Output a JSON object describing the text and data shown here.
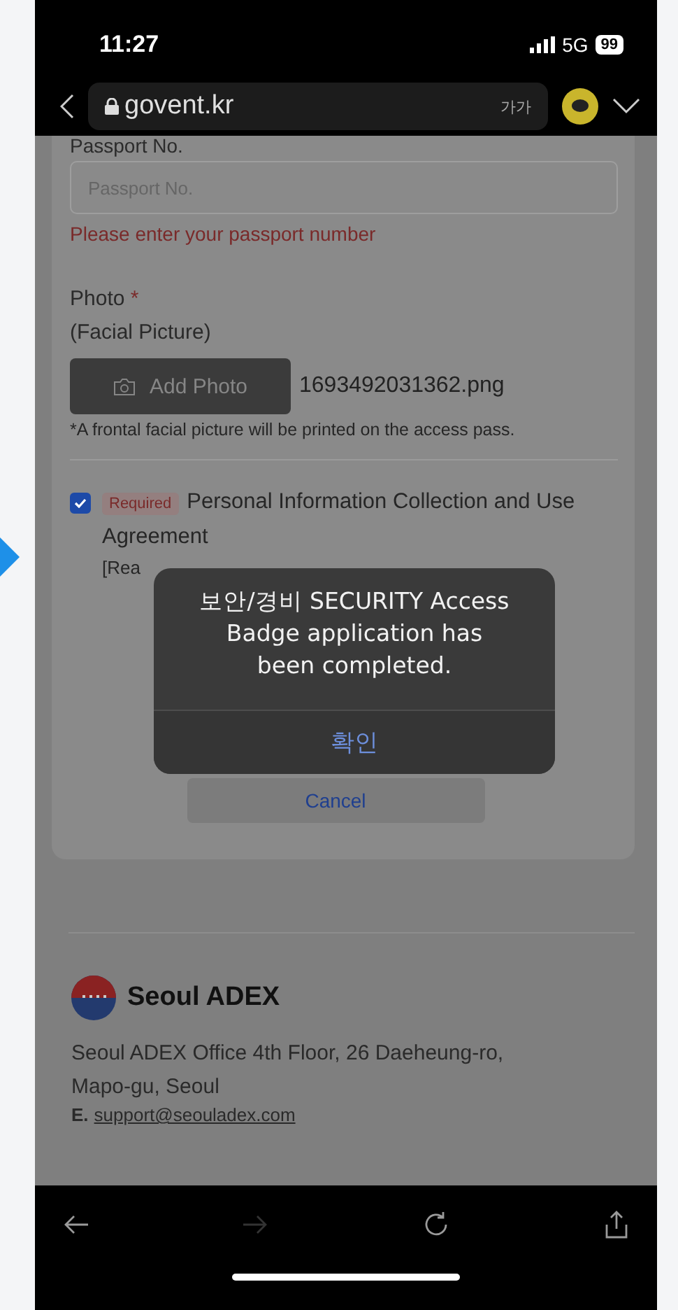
{
  "status_bar": {
    "time": "11:27",
    "network": "5G",
    "battery": "99"
  },
  "browser_bar": {
    "url": "govent.kr",
    "text_size_button": "가가"
  },
  "form": {
    "passport_label": "Passport No.",
    "passport_placeholder": "Passport No.",
    "passport_error": "Please enter your passport number",
    "photo_label": "Photo",
    "required_mark": "*",
    "photo_sublabel": "(Facial Picture)",
    "add_photo_button": "Add Photo",
    "file_name": "1693492031362.png",
    "photo_note": "*A frontal facial picture will be printed on the access pass.",
    "consent": {
      "checked": true,
      "badge": "Required",
      "label": "Personal Information Collection and Use Agreement",
      "link_text": "[Rea"
    },
    "cancel_button": "Cancel"
  },
  "dialog": {
    "message": "보안/경비 SECURITY Access Badge application has been completed.",
    "confirm_button": "확인"
  },
  "footer": {
    "brand": "Seoul ADEX",
    "address": "Seoul ADEX Office 4th Floor, 26 Daeheung-ro, Mapo-gu, Seoul",
    "email_label": "E.",
    "email": "support@seouladex.com"
  },
  "toolbar": [
    {
      "kind": "back",
      "disabled": false
    },
    {
      "kind": "forward",
      "disabled": true
    },
    {
      "kind": "reload",
      "disabled": false
    },
    {
      "kind": "share",
      "disabled": false
    }
  ]
}
